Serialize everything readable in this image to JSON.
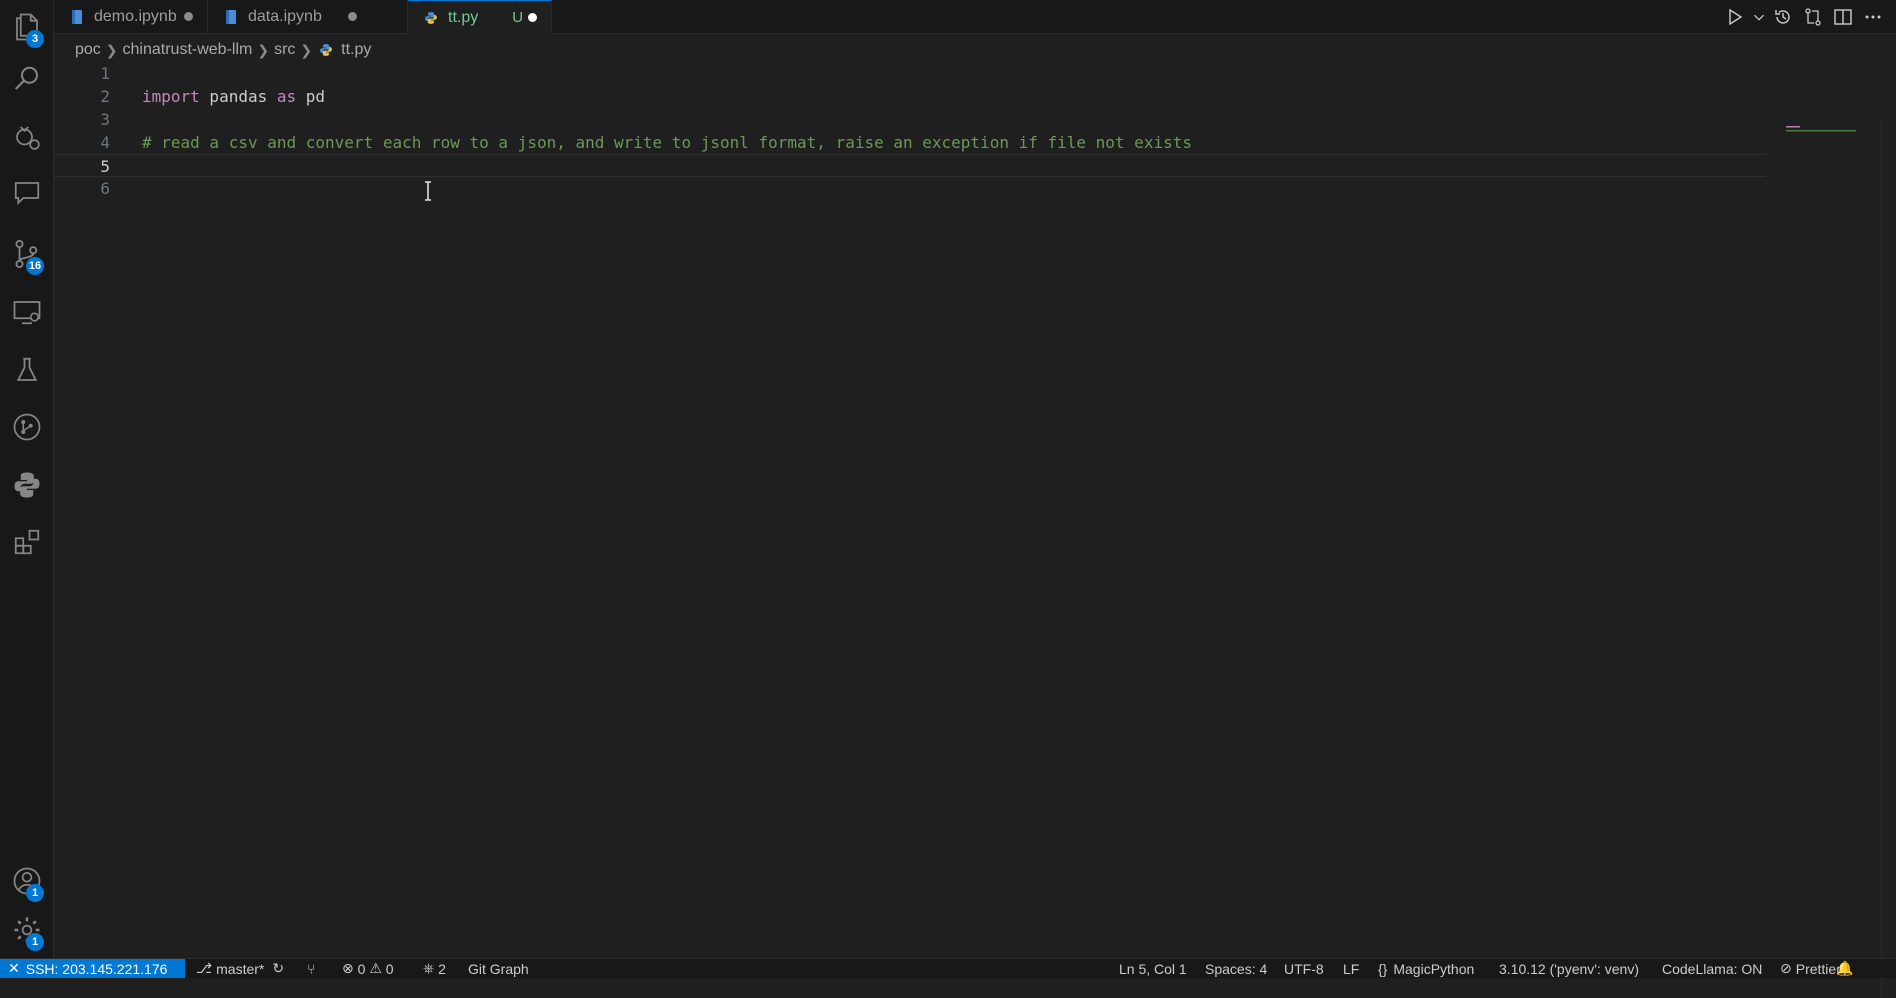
{
  "activity_bar": {
    "explorer_badge": "3",
    "source_control_badge": "16",
    "accounts_badge": "1",
    "manage_badge": "1"
  },
  "tabs": [
    {
      "label": "demo.ipynb",
      "status": ""
    },
    {
      "label": "data.ipynb",
      "status": ""
    },
    {
      "label": "tt.py",
      "status": "U"
    }
  ],
  "breadcrumb": [
    "poc",
    "chinatrust-web-llm",
    "src",
    "tt.py"
  ],
  "editor": {
    "lines": [
      {
        "number": "1",
        "tokens": []
      },
      {
        "number": "2",
        "tokens": [
          [
            "kw",
            "import"
          ],
          [
            "id",
            " pandas "
          ],
          [
            "kw",
            "as"
          ],
          [
            "id",
            " pd"
          ]
        ]
      },
      {
        "number": "3",
        "tokens": []
      },
      {
        "number": "4",
        "tokens": [
          [
            "cm",
            "# read a csv and convert each row to a json, and write to jsonl format, raise an exception if file not exists"
          ]
        ]
      },
      {
        "number": "5",
        "tokens": []
      },
      {
        "number": "6",
        "tokens": []
      }
    ],
    "cursor_line": "5"
  },
  "status_bar": {
    "remote": "SSH: 203.145.221.176",
    "branch": "master*",
    "errors": "0",
    "warnings": "0",
    "ports": "2",
    "git_graph": "Git Graph",
    "position": "Ln 5, Col 1",
    "spaces": "Spaces: 4",
    "encoding": "UTF-8",
    "eol": "LF",
    "language": "MagicPython",
    "interpreter": "3.10.12 ('pyenv': venv)",
    "codellama": "CodeLlama: ON",
    "prettier": "Prettier"
  },
  "colors": {
    "accent": "#0078d4",
    "keyword": "#c586c0",
    "comment": "#6a9955",
    "untracked": "#73c991"
  }
}
